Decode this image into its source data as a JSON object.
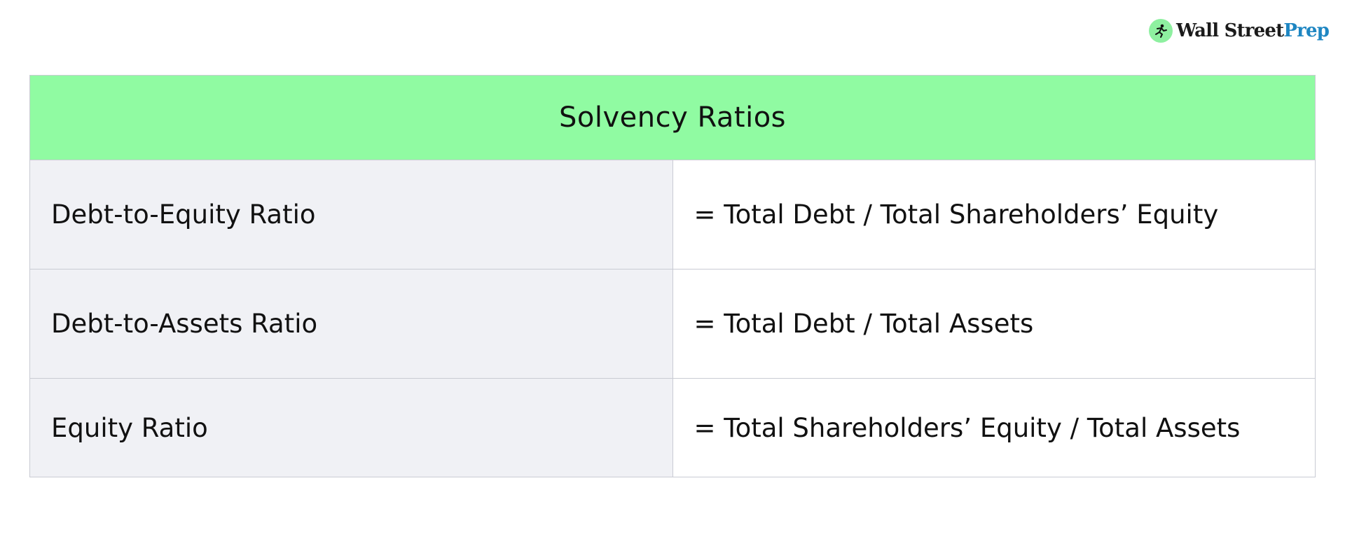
{
  "brand": {
    "name_part1": "Wall Street",
    "name_part2": "Prep",
    "icon": "running-figure-icon",
    "icon_bg_color": "#8ef0a0",
    "accent_color": "#1e86c2"
  },
  "table": {
    "title": "Solvency Ratios",
    "header_color": "#90fba2",
    "label_bg_color": "#f0f1f5",
    "rows": [
      {
        "label": "Debt-to-Equity Ratio",
        "formula": "= Total Debt / Total Shareholders’ Equity"
      },
      {
        "label": "Debt-to-Assets Ratio",
        "formula": "= Total Debt / Total Assets"
      },
      {
        "label": "Equity Ratio",
        "formula": "= Total Shareholders’ Equity / Total Assets"
      }
    ]
  }
}
